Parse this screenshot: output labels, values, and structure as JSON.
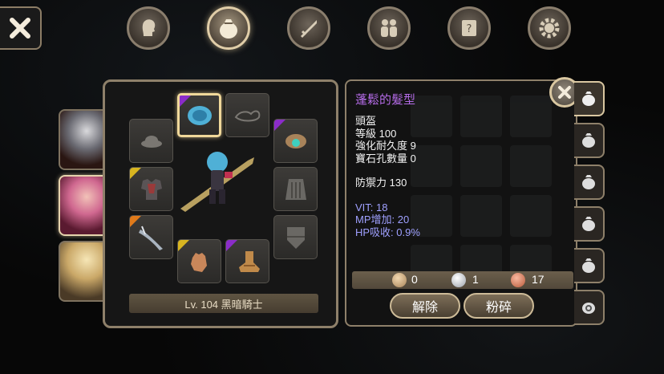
{
  "top_nav": {
    "close_icon": "close-x-icon",
    "tabs": [
      {
        "icon": "character-head-icon",
        "active": false
      },
      {
        "icon": "bag-icon",
        "active": true
      },
      {
        "icon": "skill-sword-icon",
        "active": false
      },
      {
        "icon": "party-icon",
        "active": false
      },
      {
        "icon": "quest-scroll-icon",
        "active": false
      },
      {
        "icon": "settings-gear-icon",
        "active": false
      }
    ]
  },
  "characters": [
    {
      "name": "white-hair-character",
      "active": false
    },
    {
      "name": "pink-hair-character",
      "active": true
    },
    {
      "name": "blonde-character",
      "active": false
    }
  ],
  "equipment": {
    "level_label": "Lv. 104 黑暗騎士",
    "slots": [
      {
        "id": "hat",
        "rarity": null
      },
      {
        "id": "hair",
        "rarity": "purple",
        "selected": true
      },
      {
        "id": "face",
        "rarity": null
      },
      {
        "id": "earring",
        "rarity": "purple"
      },
      {
        "id": "armor",
        "rarity": "yellow"
      },
      {
        "id": "cape",
        "rarity": null
      },
      {
        "id": "weapon",
        "rarity": "orange"
      },
      {
        "id": "shield",
        "rarity": null
      },
      {
        "id": "gloves",
        "rarity": "yellow"
      },
      {
        "id": "boots",
        "rarity": "purple"
      }
    ]
  },
  "item_info": {
    "name": "蓬鬆的髮型",
    "type": "頭盔",
    "level": "等級 100",
    "durability": "強化耐久度 9",
    "gem_slots": "寶石孔數量 0",
    "defense": "防禦力 130",
    "stats": [
      "VIT: 18",
      "MP增加: 20",
      "HP吸收: 0.9%"
    ],
    "colors": {
      "name": "#b46be6",
      "stat": "#9fa0ff"
    }
  },
  "currency": {
    "gold": "0",
    "silver": "1",
    "copper": "17"
  },
  "buttons": {
    "unequip": "解除",
    "crush": "粉碎"
  }
}
